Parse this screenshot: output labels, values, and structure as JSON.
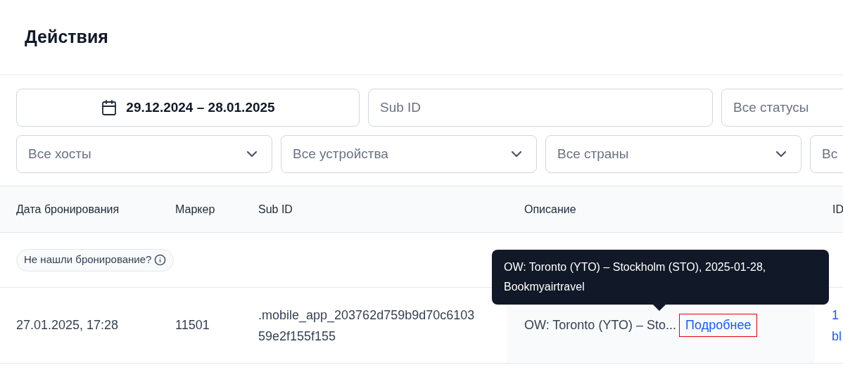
{
  "title": "Действия",
  "filters_row_1": [
    {
      "kind": "date",
      "value": "29.12.2024 – 28.01.2025"
    },
    {
      "kind": "input",
      "placeholder": "Sub ID"
    },
    {
      "kind": "select",
      "value": "Все статусы"
    }
  ],
  "filters_row_2": [
    {
      "kind": "select",
      "value": "Все хосты",
      "chevron": true
    },
    {
      "kind": "select",
      "value": "Все устройства",
      "chevron": true
    },
    {
      "kind": "select",
      "value": "Все страны",
      "chevron": true
    },
    {
      "kind": "select",
      "value": "Вс"
    }
  ],
  "table": {
    "columns": [
      "Дата бронирования",
      "Маркер",
      "Sub ID",
      "Описание",
      "ID"
    ],
    "notice": "Не нашли бронирование?",
    "rows": [
      {
        "date": "27.01.2025, 17:28",
        "marker": "11501",
        "sub_id": ".mobile_app_203762d759b9d70c610359e2f155f155",
        "description": "OW: Toronto (YTO) – Sto...",
        "link": {
          "label": "Подробнее",
          "highlighted": true
        },
        "id": [
          "1",
          "bl"
        ]
      }
    ]
  },
  "tooltip": "OW: Toronto (YTO) – Stockholm (STO), 2025-01-28, Bookmyairtravel"
}
